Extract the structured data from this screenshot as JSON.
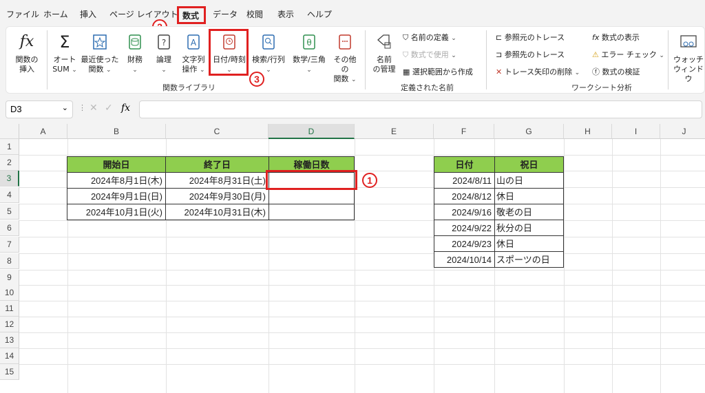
{
  "menu": {
    "tabs": [
      "ファイル",
      "ホーム",
      "挿入",
      "ページ レイアウト",
      "数式",
      "データ",
      "校閲",
      "表示",
      "ヘルプ"
    ],
    "active_tab": "数式"
  },
  "ribbon": {
    "function_library": {
      "insert_function": "関数の\n挿入",
      "autosum_1": "オート",
      "autosum_2": "SUM",
      "recent_1": "最近使った",
      "recent_2": "関数",
      "financial": "財務",
      "logical": "論理",
      "text_1": "文字列",
      "text_2": "操作",
      "datetime": "日付/時刻",
      "lookup": "検索/行列",
      "math": "数学/三角",
      "more_1": "その他の",
      "more_2": "関数",
      "group_label": "関数ライブラリ"
    },
    "defined_names": {
      "name_manager_1": "名前",
      "name_manager_2": "の管理",
      "define_name": "名前の定義",
      "use_in_formula": "数式で使用",
      "create_from_selection": "選択範囲から作成",
      "group_label": "定義された名前"
    },
    "formula_auditing": {
      "trace_precedents": "参照元のトレース",
      "trace_dependents": "参照先のトレース",
      "remove_arrows": "トレース矢印の削除",
      "show_formulas": "数式の表示",
      "error_checking": "エラー チェック",
      "evaluate_formula": "数式の検証",
      "group_label": "ワークシート分析",
      "watch_window_1": "ウォッチ",
      "watch_window_2": "ウィンドウ"
    }
  },
  "formula_bar": {
    "name_box": "D3",
    "fx": "fx",
    "value": ""
  },
  "sheet": {
    "columns": [
      "A",
      "B",
      "C",
      "D",
      "E",
      "F",
      "G",
      "H",
      "I",
      "J"
    ],
    "selected_column": "D",
    "rows": [
      "1",
      "2",
      "3",
      "4",
      "5",
      "6",
      "7",
      "8",
      "9",
      "10",
      "11",
      "12",
      "13",
      "14",
      "15"
    ],
    "selected_row": "3",
    "table1": {
      "headers": [
        "開始日",
        "終了日",
        "稼働日数"
      ],
      "rows": [
        [
          "2024年8月1日(木)",
          "2024年8月31日(土)",
          ""
        ],
        [
          "2024年9月1日(日)",
          "2024年9月30日(月)",
          ""
        ],
        [
          "2024年10月1日(火)",
          "2024年10月31日(木)",
          ""
        ]
      ]
    },
    "table2": {
      "headers": [
        "日付",
        "祝日"
      ],
      "rows": [
        [
          "2024/8/11",
          "山の日"
        ],
        [
          "2024/8/12",
          "休日"
        ],
        [
          "2024/9/16",
          "敬老の日"
        ],
        [
          "2024/9/22",
          "秋分の日"
        ],
        [
          "2024/9/23",
          "休日"
        ],
        [
          "2024/10/14",
          "スポーツの日"
        ]
      ]
    }
  },
  "annotations": {
    "step1": "1",
    "step2": "2",
    "step3": "3"
  },
  "colors": {
    "header_green": "#8fce4e",
    "highlight_red": "#e02020",
    "excel_green": "#217346"
  }
}
